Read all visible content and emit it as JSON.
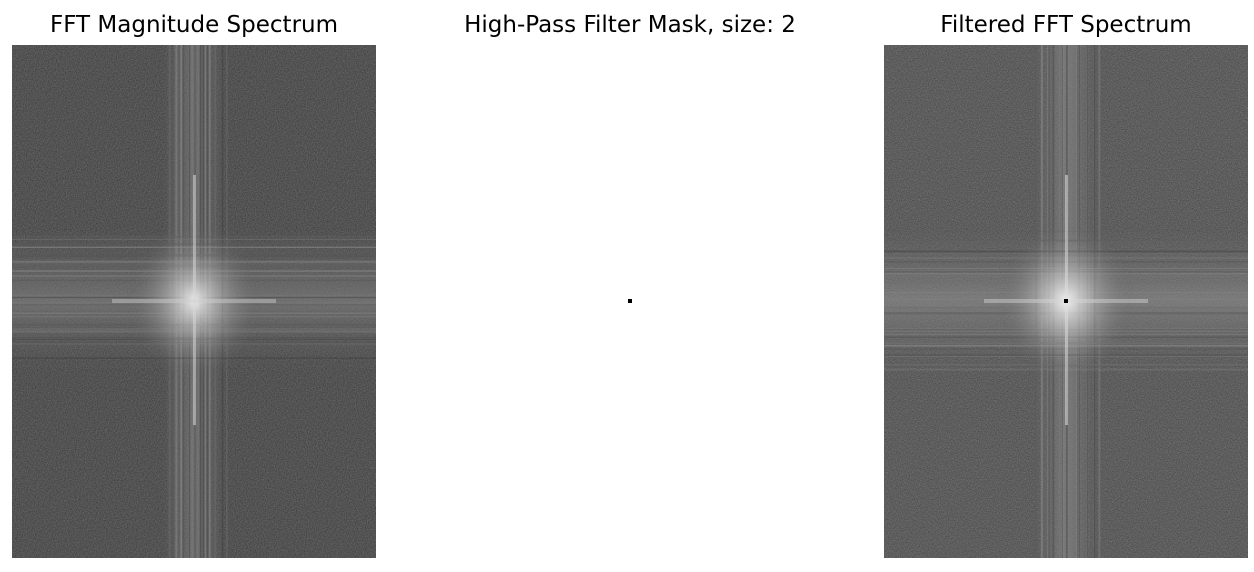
{
  "figure": {
    "panels": [
      {
        "id": "magnitude",
        "title": "FFT Magnitude Spectrum",
        "kind": "spectrum",
        "colormap": "gray",
        "masked_center": false
      },
      {
        "id": "mask",
        "title": "High-Pass Filter Mask, size: 2",
        "kind": "mask",
        "colormap": "gray",
        "background_color": "#ffffff",
        "blocked_color": "#000000"
      },
      {
        "id": "filtered",
        "title": "Filtered FFT Spectrum",
        "kind": "spectrum",
        "colormap": "gray",
        "masked_center": true
      }
    ]
  }
}
